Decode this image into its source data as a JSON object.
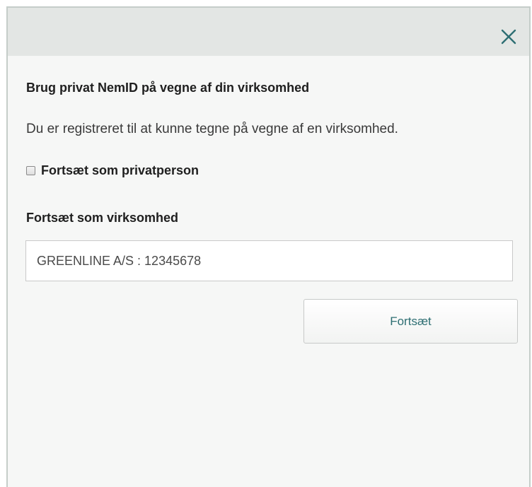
{
  "dialog": {
    "close_icon": "close-icon",
    "heading": "Brug privat NemID på vegne af din virksomhed",
    "description": "Du er registreret til at kunne tegne på vegne af en virksomhed.",
    "private_checkbox": {
      "label": "Fortsæt som privatperson",
      "checked": false
    },
    "company_section_label": "Fortsæt som virksomhed",
    "company_select_value": "GREENLINE A/S : 12345678",
    "continue_button": "Fortsæt",
    "accent_color": "#2e6f73"
  }
}
